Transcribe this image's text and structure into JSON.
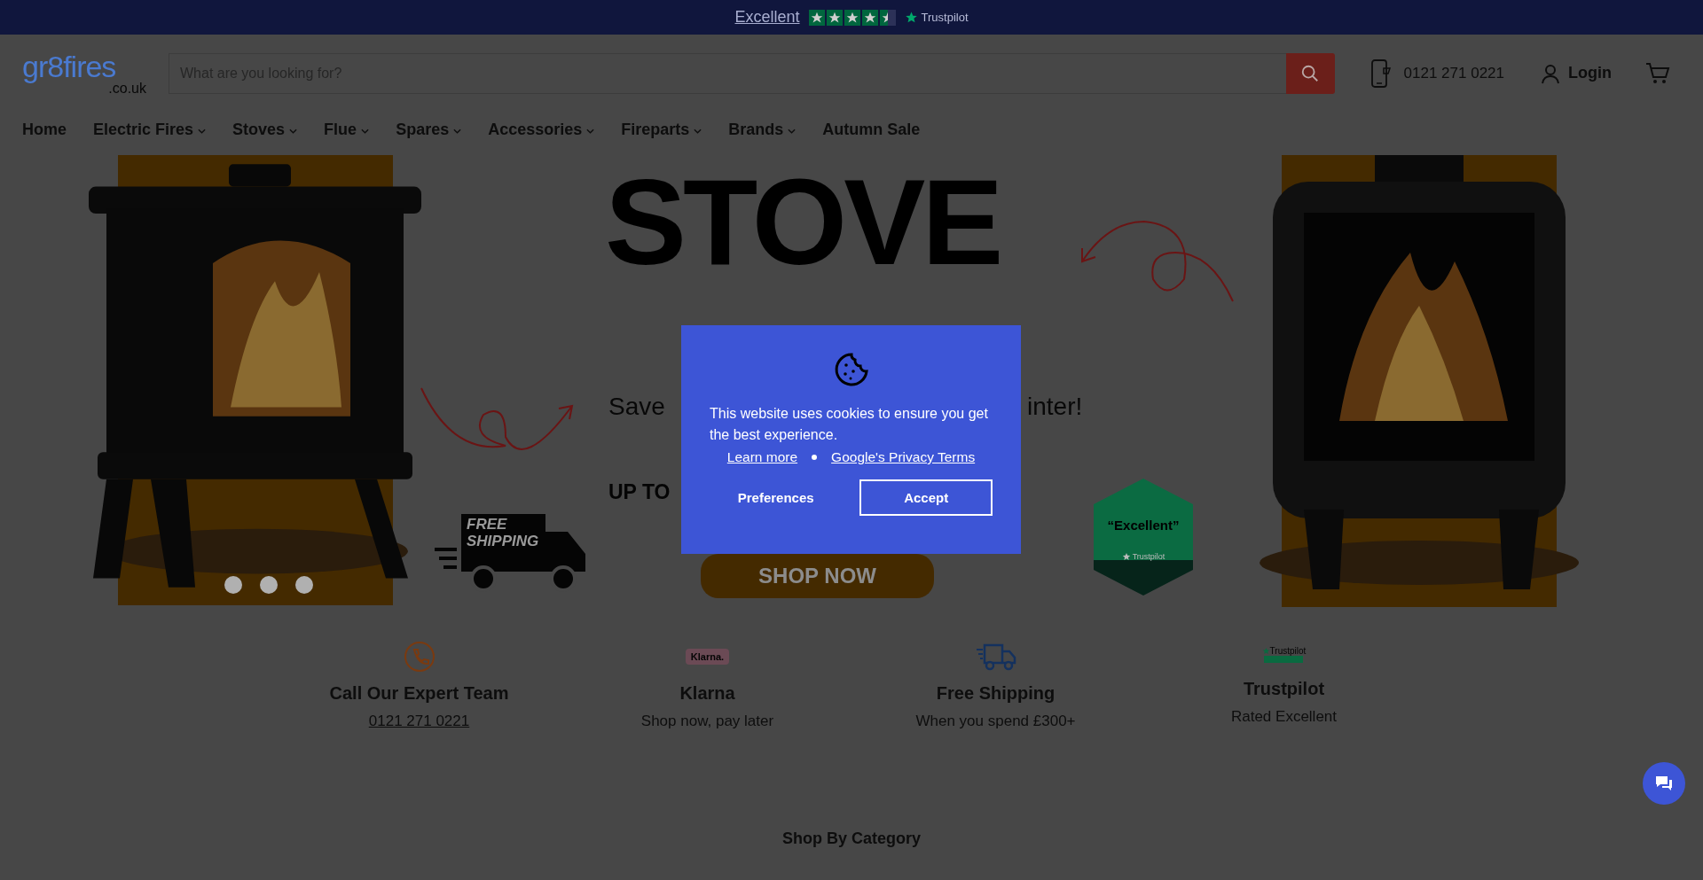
{
  "top_bar": {
    "rating_text": "Excellent",
    "stars": 4.5,
    "brand": "Trustpilot"
  },
  "header": {
    "logo": {
      "name": "gr8fires",
      "domain": ".co.uk"
    },
    "search": {
      "placeholder": "What are you looking for?"
    },
    "phone": "0121 271 0221",
    "login": "Login"
  },
  "nav": [
    {
      "label": "Home",
      "dropdown": false
    },
    {
      "label": "Electric Fires",
      "dropdown": true
    },
    {
      "label": "Stoves",
      "dropdown": true
    },
    {
      "label": "Flue",
      "dropdown": true
    },
    {
      "label": "Spares",
      "dropdown": true
    },
    {
      "label": "Accessories",
      "dropdown": true
    },
    {
      "label": "Fireparts",
      "dropdown": true
    },
    {
      "label": "Brands",
      "dropdown": true
    },
    {
      "label": "Autumn Sale",
      "dropdown": false
    }
  ],
  "banner": {
    "headline": "STOVE",
    "tagline_start": "Save",
    "tagline_end": "inter!",
    "up_to": "UP TO",
    "truck_text": [
      "FREE",
      "SHIPPING"
    ],
    "button": "SHOP NOW",
    "badge": "“Excellent”",
    "badge_brand": "Trustpilot"
  },
  "features": [
    {
      "kind": "phone",
      "title": "Call Our Expert Team",
      "subtitle": "0121 271 0221",
      "link": true
    },
    {
      "kind": "klarna",
      "icon_text": "Klarna.",
      "title": "Klarna",
      "subtitle": "Shop now, pay later",
      "link": false
    },
    {
      "kind": "truck",
      "title": "Free Shipping",
      "subtitle": "When you spend £300+",
      "link": false
    },
    {
      "kind": "trustpilot",
      "icon_text": "Trustpilot",
      "title": "Trustpilot",
      "subtitle": "Rated Excellent",
      "link": false
    }
  ],
  "section_title": "Shop By Category",
  "cookie": {
    "message": "This website uses cookies to ensure you get the best experience.",
    "links": [
      "Learn more",
      "Google's Privacy Terms"
    ],
    "buttons": [
      {
        "label": "Preferences",
        "kind": "text"
      },
      {
        "label": "Accept",
        "kind": "outlined"
      }
    ]
  }
}
